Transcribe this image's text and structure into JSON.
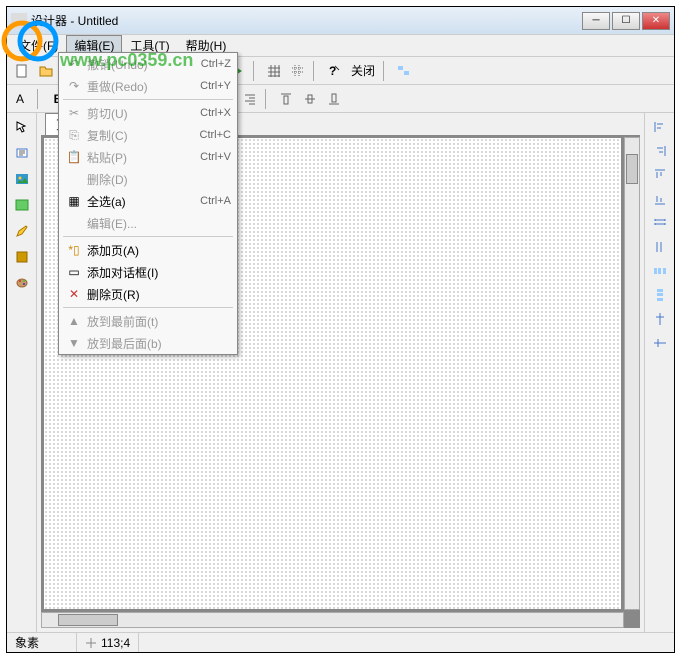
{
  "window": {
    "title": "设计器 - Untitled"
  },
  "menubar": {
    "file": "文件(F)",
    "edit": "编辑(E)",
    "tool": "工具(T)",
    "help": "帮助(H)"
  },
  "toolbar": {
    "close": "关闭"
  },
  "tab": {
    "page1": "页1"
  },
  "edit_menu": {
    "undo": "撤销(Undo)",
    "undo_sc": "Ctrl+Z",
    "redo": "重做(Redo)",
    "redo_sc": "Ctrl+Y",
    "cut": "剪切(U)",
    "cut_sc": "Ctrl+X",
    "copy": "复制(C)",
    "copy_sc": "Ctrl+C",
    "paste": "粘贴(P)",
    "paste_sc": "Ctrl+V",
    "delete": "删除(D)",
    "selectall": "全选(a)",
    "selectall_sc": "Ctrl+A",
    "editt": "编辑(E)...",
    "addpg": "添加页(A)",
    "adddlg": "添加对话框(I)",
    "delpg": "删除页(R)",
    "bringfront": "放到最前面(t)",
    "sendback": "放到最后面(b)"
  },
  "status": {
    "label": "象素",
    "coord": "113;4"
  },
  "watermark": "www.pc0359.cn"
}
